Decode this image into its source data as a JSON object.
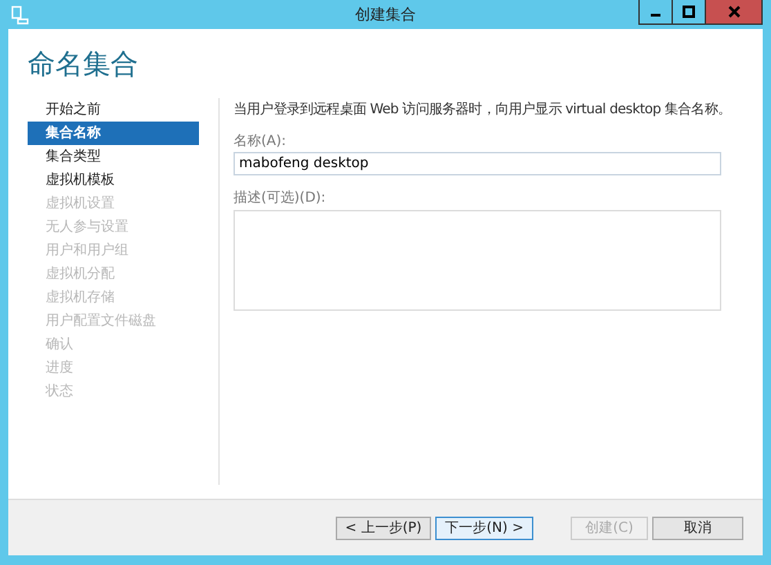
{
  "window": {
    "title": "创建集合"
  },
  "page_title": "命名集合",
  "sidebar": {
    "items": [
      {
        "label": "开始之前",
        "selected": false,
        "disabled": false
      },
      {
        "label": "集合名称",
        "selected": true,
        "disabled": false
      },
      {
        "label": "集合类型",
        "selected": false,
        "disabled": false
      },
      {
        "label": "虚拟机模板",
        "selected": false,
        "disabled": false
      },
      {
        "label": "虚拟机设置",
        "selected": false,
        "disabled": true
      },
      {
        "label": "无人参与设置",
        "selected": false,
        "disabled": true
      },
      {
        "label": "用户和用户组",
        "selected": false,
        "disabled": true
      },
      {
        "label": "虚拟机分配",
        "selected": false,
        "disabled": true
      },
      {
        "label": "虚拟机存储",
        "selected": false,
        "disabled": true
      },
      {
        "label": "用户配置文件磁盘",
        "selected": false,
        "disabled": true
      },
      {
        "label": "确认",
        "selected": false,
        "disabled": true
      },
      {
        "label": "进度",
        "selected": false,
        "disabled": true
      },
      {
        "label": "状态",
        "selected": false,
        "disabled": true
      }
    ]
  },
  "description": "当用户登录到远程桌面 Web 访问服务器时，向用户显示 virtual desktop 集合名称。",
  "name_field": {
    "label": "名称(A):",
    "value": "mabofeng desktop"
  },
  "description_field": {
    "label": "描述(可选)(D):"
  },
  "buttons": [
    {
      "label": "< 上一步(P)",
      "disabled": false,
      "focused": false
    },
    {
      "label": "下一步(N) >",
      "disabled": false,
      "focused": true
    },
    {
      "label": "创建(C)",
      "disabled": true,
      "focused": false
    },
    {
      "label": "取消",
      "disabled": false,
      "focused": false
    }
  ]
}
